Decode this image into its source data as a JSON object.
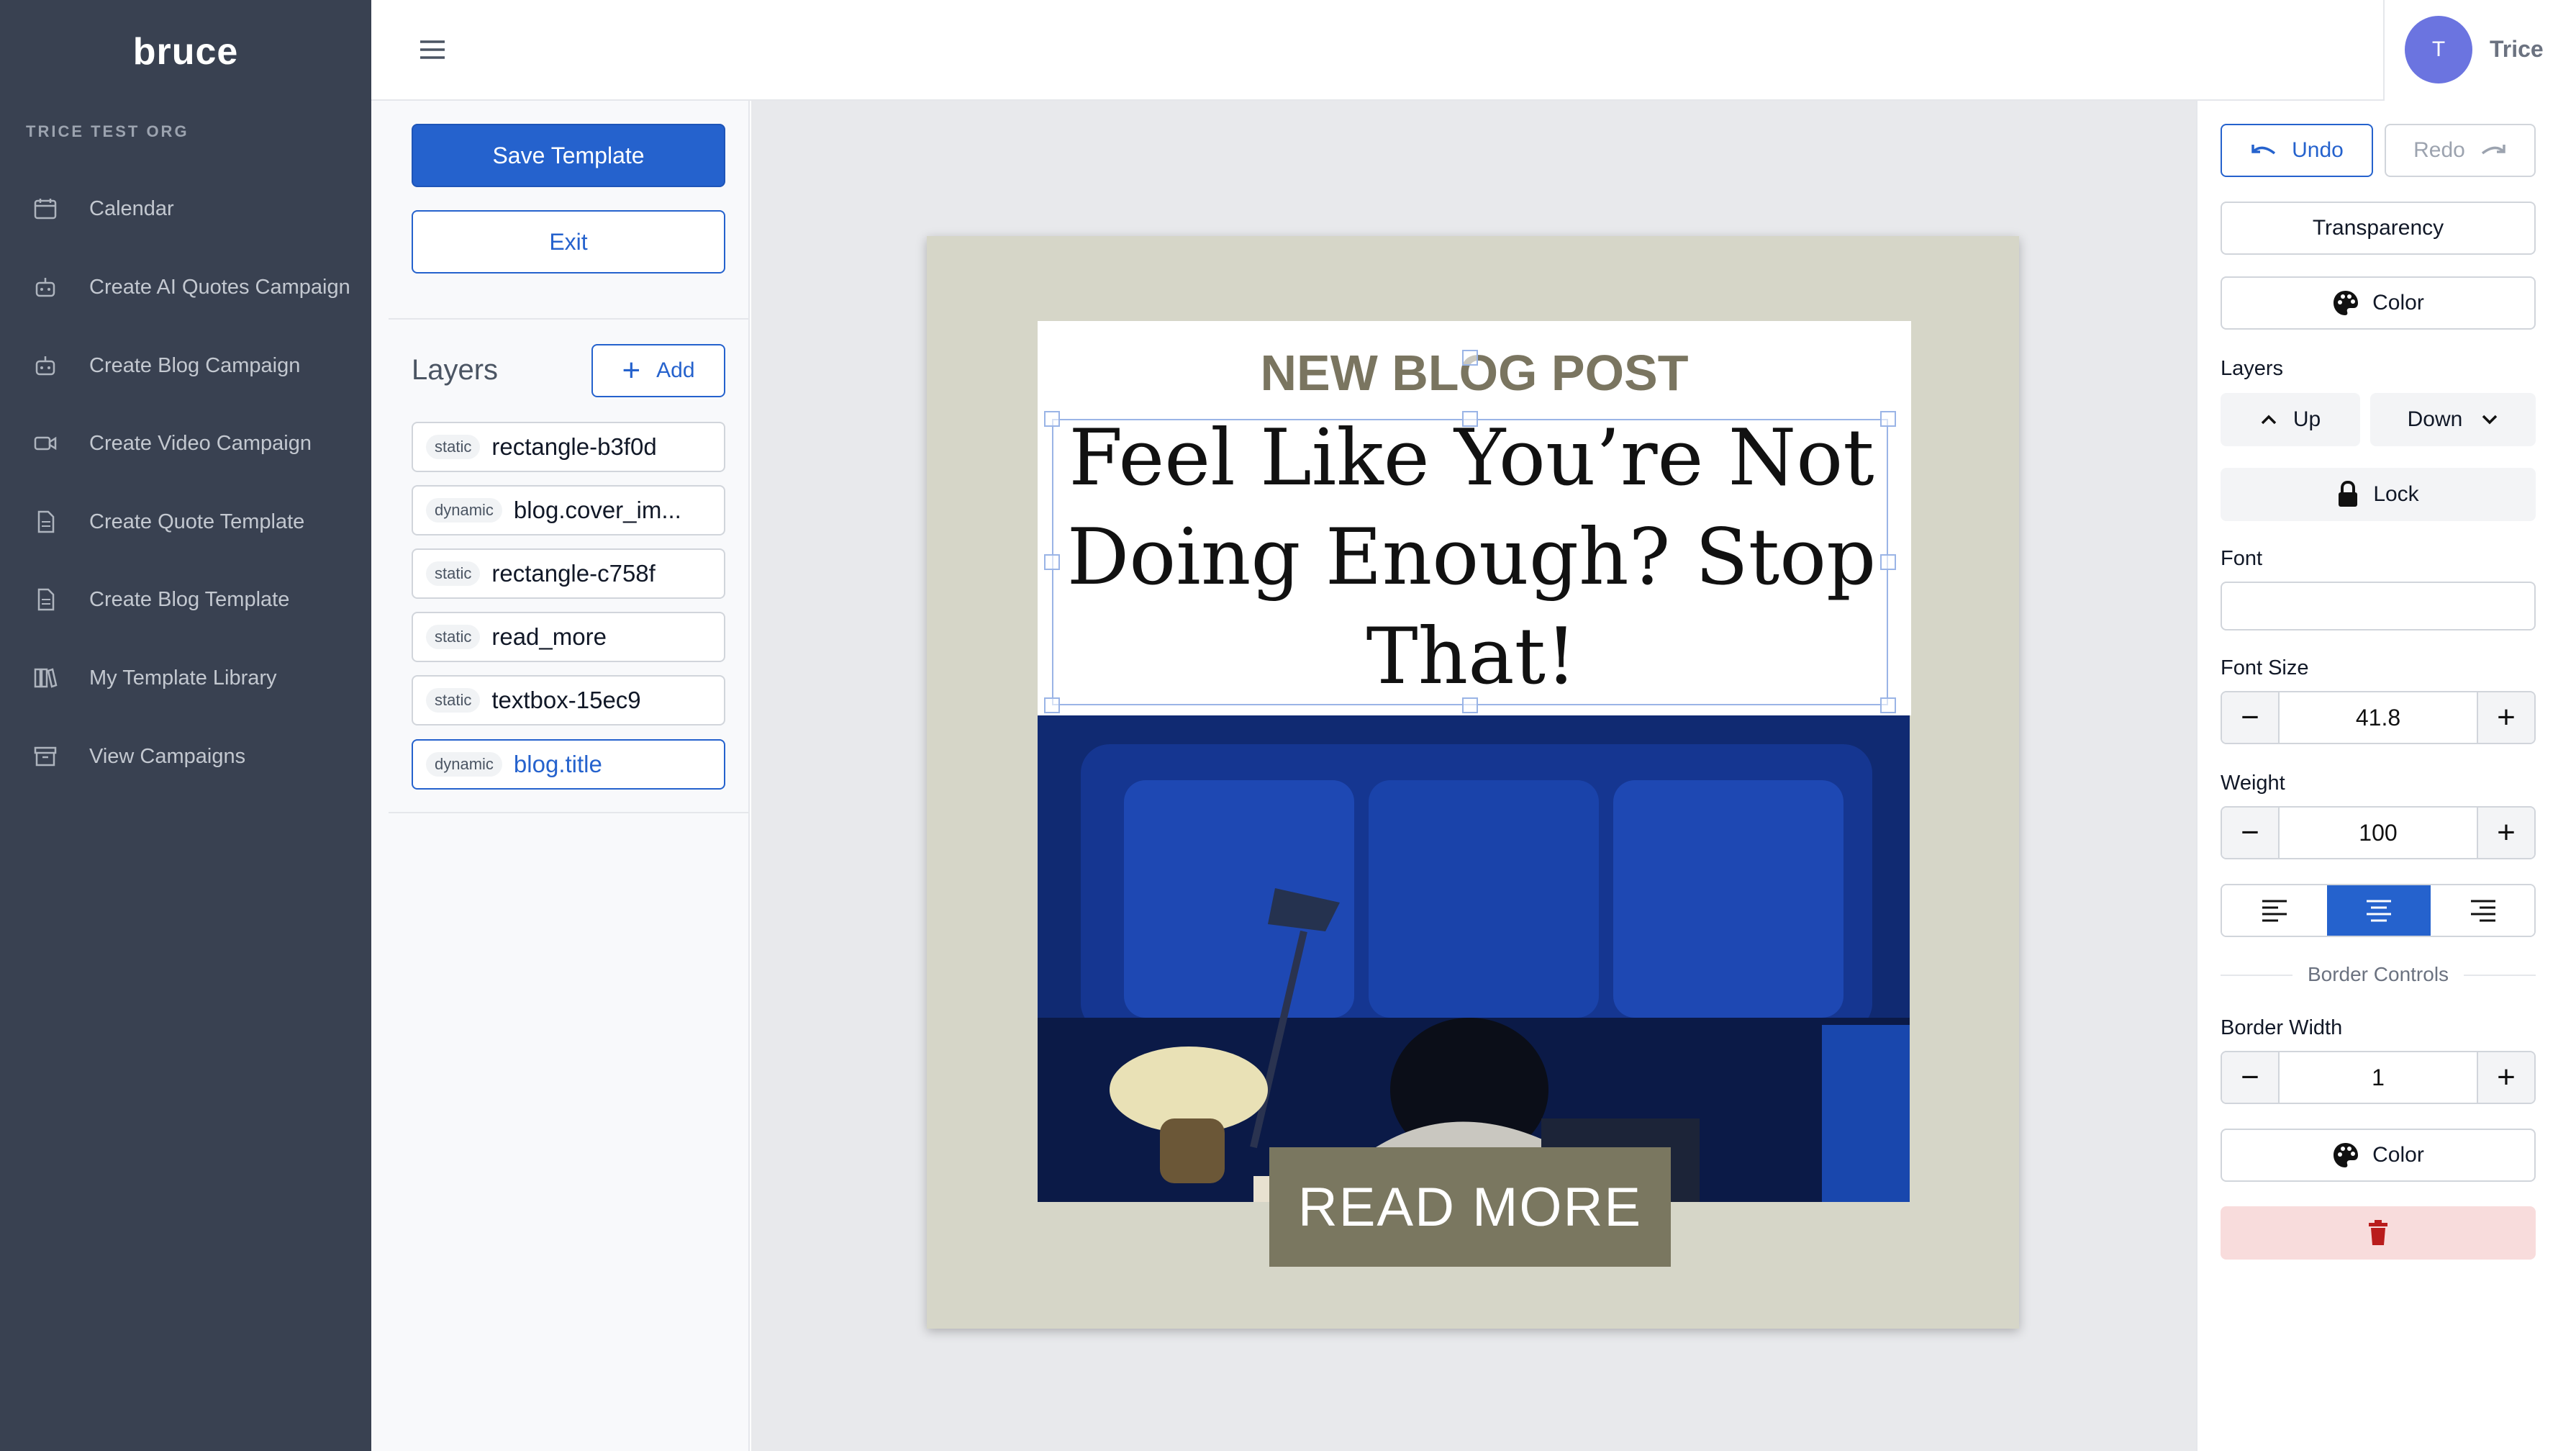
{
  "sidebar": {
    "brand": "bruce",
    "org": "TRICE TEST ORG",
    "items": [
      {
        "label": "Calendar",
        "icon": "calendar-icon"
      },
      {
        "label": "Create AI Quotes Campaign",
        "icon": "robot-icon"
      },
      {
        "label": "Create Blog Campaign",
        "icon": "robot-icon"
      },
      {
        "label": "Create Video Campaign",
        "icon": "video-icon"
      },
      {
        "label": "Create Quote Template",
        "icon": "document-icon"
      },
      {
        "label": "Create Blog Template",
        "icon": "document-icon"
      },
      {
        "label": "My Template Library",
        "icon": "library-icon"
      },
      {
        "label": "View Campaigns",
        "icon": "archive-icon"
      }
    ]
  },
  "header": {
    "user": {
      "initial": "T",
      "name": "Trice"
    }
  },
  "tools": {
    "save_label": "Save Template",
    "exit_label": "Exit",
    "layers_title": "Layers",
    "add_label": "Add",
    "layers": [
      {
        "tag": "static",
        "name": "rectangle-b3f0d",
        "selected": false
      },
      {
        "tag": "dynamic",
        "name": "blog.cover_im...",
        "selected": false
      },
      {
        "tag": "static",
        "name": "rectangle-c758f",
        "selected": false
      },
      {
        "tag": "static",
        "name": "read_more",
        "selected": false
      },
      {
        "tag": "static",
        "name": "textbox-15ec9",
        "selected": false
      },
      {
        "tag": "dynamic",
        "name": "blog.title",
        "selected": true
      }
    ]
  },
  "canvas": {
    "heading": "NEW BLOG POST",
    "title_lines": [
      "Feel Like You’re Not",
      "Doing Enough? Stop",
      "That!"
    ],
    "read_more": "READ MORE",
    "background_color": "#d6d6c8",
    "button_color": "#7a7760"
  },
  "properties": {
    "undo_label": "Undo",
    "redo_label": "Redo",
    "transparency_label": "Transparency",
    "color_label": "Color",
    "layers_label": "Layers",
    "up_label": "Up",
    "down_label": "Down",
    "lock_label": "Lock",
    "font_label": "Font",
    "font_value": "",
    "font_size_label": "Font Size",
    "font_size_value": "41.8",
    "weight_label": "Weight",
    "weight_value": "100",
    "alignment": "center",
    "border_controls_label": "Border Controls",
    "border_width_label": "Border Width",
    "border_width_value": "1",
    "border_color_label": "Color",
    "accent_color": "#2562cd",
    "delete_color": "#f8dcdc"
  }
}
